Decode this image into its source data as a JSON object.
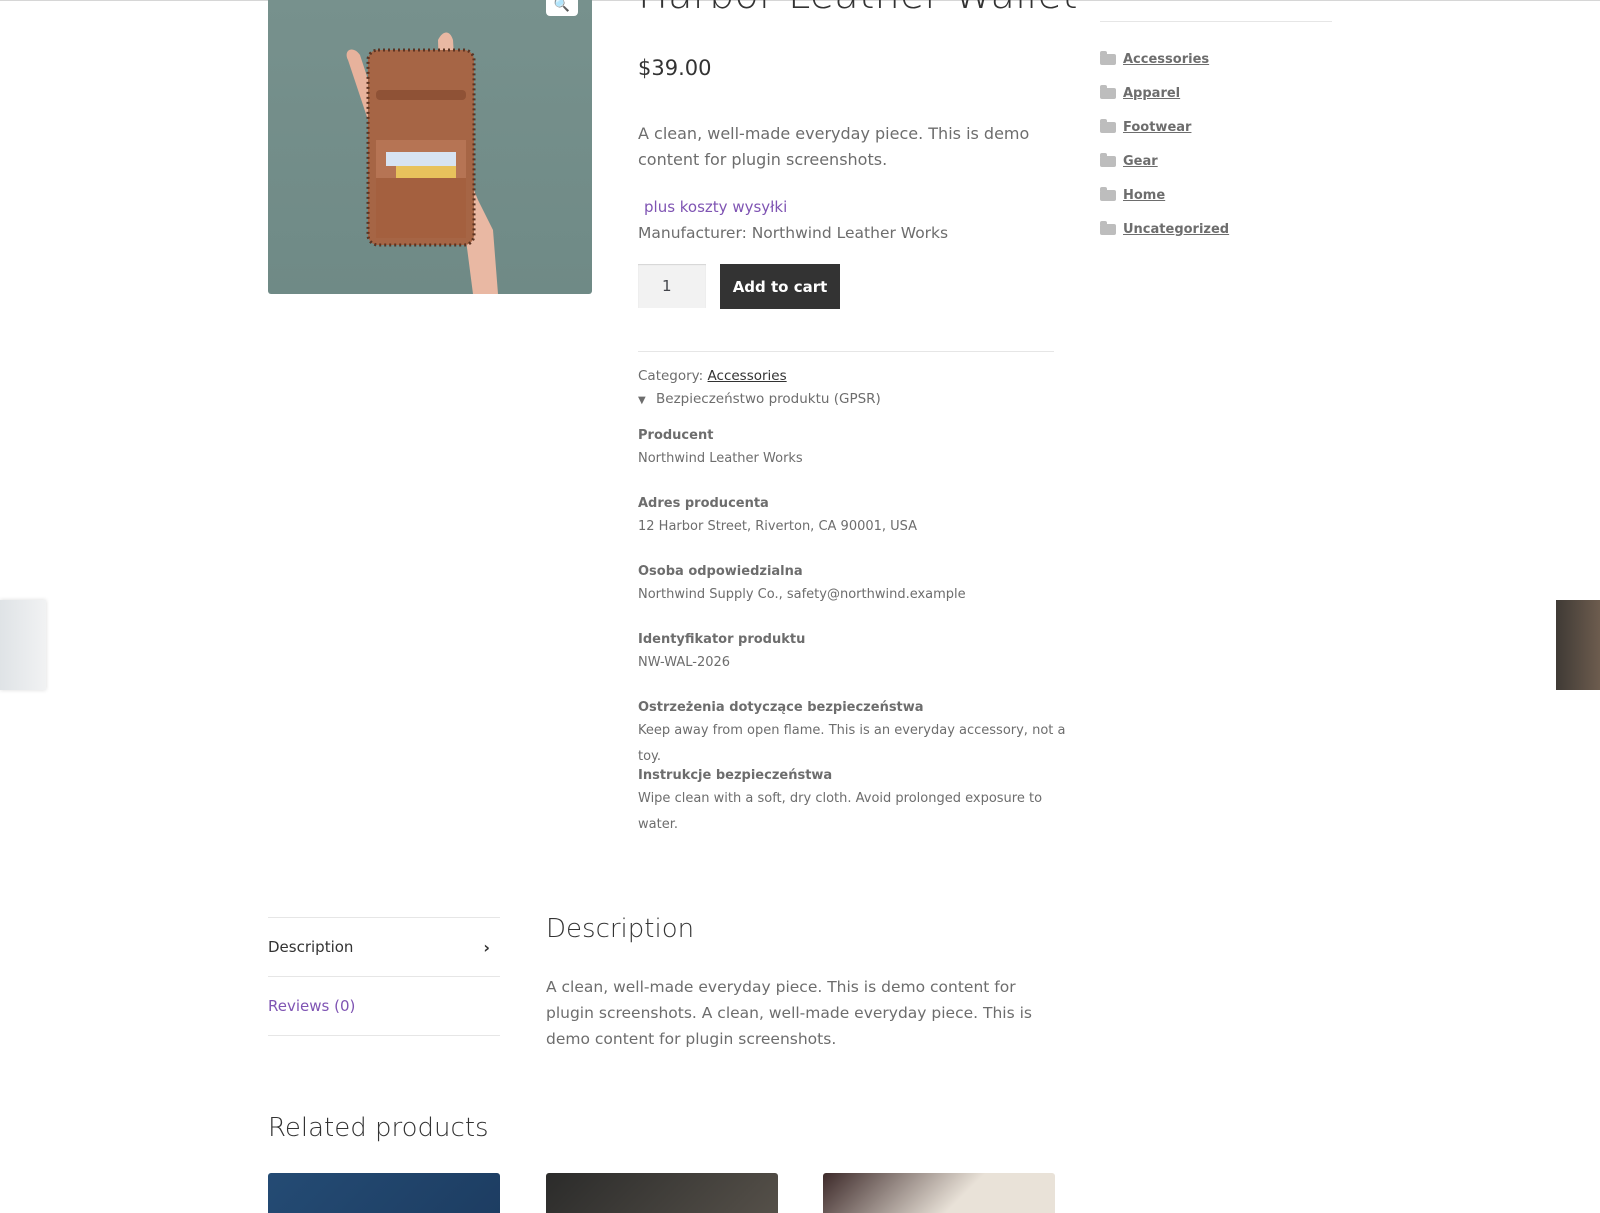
{
  "product": {
    "title": "Harbor Leather Wallet",
    "price": "$39.00",
    "short_description": "A clean, well-made everyday piece. This is demo content for plugin screenshots.",
    "shipping_note": "plus koszty wysyłki",
    "manufacturer": "Manufacturer: Northwind Leather Works",
    "quantity": "1",
    "add_to_cart_label": "Add to cart",
    "category_label": "Category:",
    "category": "Accessories",
    "gpsr_toggle": "Bezpieczeństwo produktu (GPSR)",
    "gpsr": [
      {
        "label": "Producent",
        "value": "Northwind Leather Works"
      },
      {
        "label": "Adres producenta",
        "value": "12 Harbor Street, Riverton, CA 90001, USA"
      },
      {
        "label": "Osoba odpowiedzialna",
        "value": "Northwind Supply Co., safety@northwind.example"
      },
      {
        "label": "Identyfikator produktu",
        "value": "NW-WAL-2026"
      },
      {
        "label": "Ostrzeżenia dotyczące bezpieczeństwa",
        "value": "Keep away from open flame. This is an everyday accessory, not a toy."
      },
      {
        "label": "Instrukcje bezpieczeństwa",
        "value": "Wipe clean with a soft, dry cloth. Avoid prolonged exposure to water."
      }
    ]
  },
  "sidebar": {
    "categories": [
      "Accessories",
      "Apparel",
      "Footwear",
      "Gear",
      "Home",
      "Uncategorized"
    ]
  },
  "tabs": {
    "items": [
      "Description",
      "Reviews (0)"
    ],
    "description_heading": "Description",
    "description_text": "A clean, well-made everyday piece. This is demo content for plugin screenshots. A clean, well-made everyday piece. This is demo content for plugin screenshots."
  },
  "related": {
    "heading": "Related products"
  },
  "icons": {
    "zoom": "magnifier-icon",
    "category": "folder-icon",
    "tab_arrow": "chevron-right-icon",
    "toggle": "triangle-down-icon"
  },
  "colors": {
    "accent_purple": "#7f54b3",
    "button_dark": "#333333",
    "text": "#6d6d6d"
  }
}
